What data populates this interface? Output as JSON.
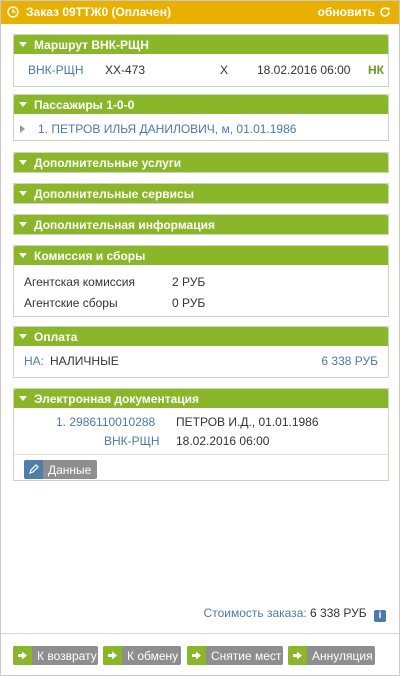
{
  "header": {
    "title": "Заказ 09ТТЖ0 (Оплачен)",
    "refresh_label": "обновить"
  },
  "route": {
    "title": "Маршрут ВНК-РЩН",
    "segment": "ВНК-РЩН",
    "flight": "ХХ-473",
    "class": "X",
    "datetime": "18.02.2016 06:00",
    "status": "НК"
  },
  "passengers": {
    "title": "Пассажиры 1-0-0",
    "items": [
      "1. ПЕТРОВ ИЛЬЯ ДАНИЛОВИЧ, м, 01.01.1986"
    ]
  },
  "extra_services": {
    "title": "Дополнительные услуги"
  },
  "extra_servicing": {
    "title": "Дополнительные сервисы"
  },
  "extra_info": {
    "title": "Дополнительная информация"
  },
  "fees": {
    "title": "Комиссия и сборы",
    "rows": [
      {
        "label": "Агентская комиссия",
        "value": "2 РУБ"
      },
      {
        "label": "Агентские сборы",
        "value": "0 РУБ"
      }
    ]
  },
  "payment": {
    "title": "Оплата",
    "prefix": "НА:",
    "method": "НАЛИЧНЫЕ",
    "amount": "6 338 РУБ"
  },
  "documents": {
    "title": "Электронная документация",
    "ticket_number": "1. 2986110010288",
    "ticket_passenger": "ПЕТРОВ И.Д., 01.01.1986",
    "ticket_segment": "ВНК-РЩН",
    "ticket_datetime": "18.02.2016 06:00",
    "data_button": "Данные"
  },
  "order_cost": {
    "label": "Стоимость заказа:",
    "value": "6 338 РУБ"
  },
  "actions": {
    "refund": "К возврату",
    "exchange": "К обмену",
    "release_seats": "Снятие мест",
    "cancel": "Аннуляция"
  },
  "colors": {
    "header": "#e8b100",
    "panel_head": "#8ab62a",
    "link": "#4a7ba6",
    "button": "#8e8e8e"
  }
}
